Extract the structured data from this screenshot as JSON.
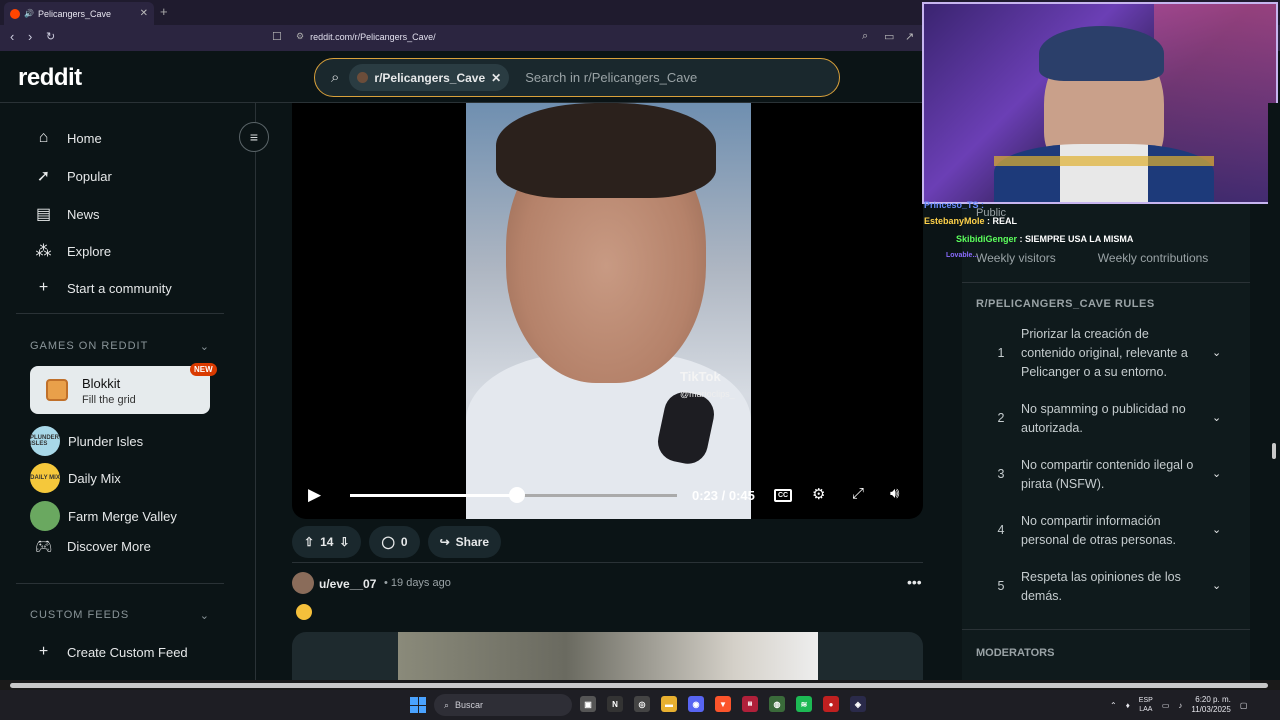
{
  "browser": {
    "tab_title": "Pelicangers_Cave",
    "url": "reddit.com/r/Pelicangers_Cave/"
  },
  "reddit": {
    "logo": "reddit",
    "search": {
      "chip_label": "r/Pelicangers_Cave",
      "placeholder": "Search in r/Pelicangers_Cave"
    }
  },
  "sidebar": {
    "nav": [
      {
        "label": "Home",
        "icon": "home-icon"
      },
      {
        "label": "Popular",
        "icon": "popular-icon"
      },
      {
        "label": "News",
        "icon": "news-icon"
      },
      {
        "label": "Explore",
        "icon": "explore-icon"
      },
      {
        "label": "Start a community",
        "icon": "plus-icon"
      }
    ],
    "games_title": "GAMES ON REDDIT",
    "featured_game": {
      "title": "Blokkit",
      "subtitle": "Fill the grid",
      "badge": "NEW"
    },
    "games": [
      {
        "label": "Plunder Isles",
        "avatar_text": "PLUNDER ISLES",
        "color": "#a8d8e8"
      },
      {
        "label": "Daily Mix",
        "avatar_text": "DAILY MIX",
        "color": "#f5c83b"
      },
      {
        "label": "Farm Merge Valley",
        "avatar_text": "",
        "color": "#6aa860"
      },
      {
        "label": "Discover More",
        "avatar_text": "",
        "color": ""
      }
    ],
    "custom_feeds_title": "CUSTOM FEEDS",
    "create_feed_label": "Create Custom Feed"
  },
  "post": {
    "video": {
      "watermark": "TikTok",
      "watermark_user": "@marioclips_",
      "time": "0:23 / 0:45",
      "progress": 0.511,
      "cc_label": "CC"
    },
    "votes": "14",
    "comments": "0",
    "share_label": "Share"
  },
  "post2": {
    "user": "u/eve__07",
    "time": "• 19 days ago"
  },
  "right_sidebar": {
    "public_label": "Public",
    "stats": [
      "Weekly visitors",
      "Weekly contributions"
    ],
    "rules_title": "R/PELICANGERS_CAVE RULES",
    "rules": [
      {
        "num": "1",
        "text": "Priorizar la creación de contenido original, relevante a Pelicanger o a su entorno."
      },
      {
        "num": "2",
        "text": "No spamming o publicidad no autorizada."
      },
      {
        "num": "3",
        "text": "No compartir contenido ilegal o pirata (NSFW)."
      },
      {
        "num": "4",
        "text": "No compartir información personal de otras personas."
      },
      {
        "num": "5",
        "text": "Respeta las opiniones de los demás."
      }
    ],
    "moderators_title": "MODERATORS"
  },
  "stream_chat": [
    {
      "user": "Princeso_TS :",
      "msg": "",
      "color": "#6a8cff"
    },
    {
      "user": "EstebanyMole",
      "msg": ": REAL",
      "color": "#ffd24a"
    },
    {
      "user": "SkibidiGenger",
      "msg": ": SIEMPRE USA LA MISMA",
      "color": "#5cff5c"
    },
    {
      "user": "Lovable...",
      "msg": "",
      "color": "#8a6cff"
    }
  ],
  "taskbar": {
    "search_label": "Buscar",
    "lang_top": "ESP",
    "lang_bottom": "LAA",
    "time": "6:20 p. m.",
    "date": "11/03/2025"
  },
  "colors": {
    "accent_search_border": "#d9a13b",
    "reddit_orange": "#ff4500",
    "bg": "#0b1416"
  }
}
